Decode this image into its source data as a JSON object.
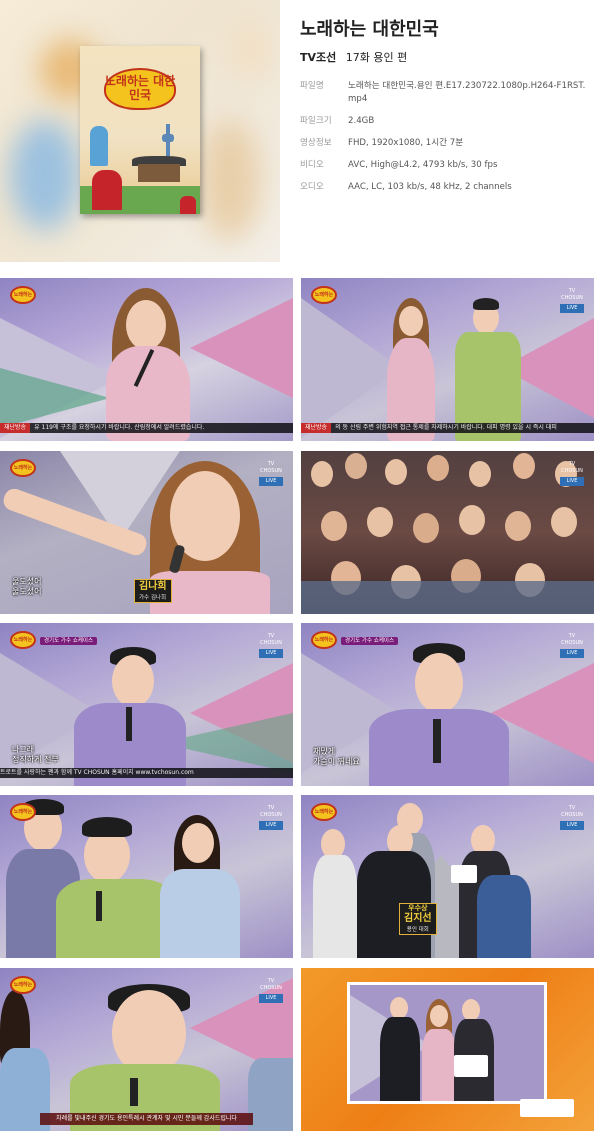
{
  "program": {
    "title": "노래하는 대한민국",
    "channel": "TV조선",
    "episode": "17화 용인 편",
    "poster_text": "노래하는 대한민국"
  },
  "meta": [
    {
      "key": "파일명",
      "value": "노래하는 대한민국.용인 편.E17.230722.1080p.H264-F1RST.mp4"
    },
    {
      "key": "파일크기",
      "value": "2.4GB"
    },
    {
      "key": "영상정보",
      "value": "FHD, 1920x1080, 1시간 7분"
    },
    {
      "key": "비디오",
      "value": "AVC, High@L4.2, 4793 kb/s, 30 fps"
    },
    {
      "key": "오디오",
      "value": "AAC, LC, 103 kb/s, 48 kHz, 2 channels"
    }
  ],
  "thumbs": {
    "t1": {
      "ticker_tag": "재난방송",
      "ticker": "유 119에 구조를 요청하시기 바랍니다. 산림청에서 알려드렸습니다."
    },
    "t2": {
      "ticker_tag": "재난방송",
      "ticker": "의 동 산림 주변 위험지역 접근 통제를 자제하시기 바랍니다. 대피 명령 있을 시 즉시 대피"
    },
    "t3": {
      "caption_line1": "울도셨어",
      "caption_line2": "울도셨어",
      "name": "김나희",
      "name_sub": "가수 김나희"
    },
    "t5": {
      "badge": "경기도 가수 쇼케이스",
      "caption_line1": "나그래",
      "caption_line2": "정직하게 전부",
      "ticker": "트로트를 사랑하는 팬과 함께 TV CHOSUN 홈페이지 www.tvchosun.com"
    },
    "t6": {
      "badge": "경기도 가수 쇼케이스",
      "caption_line1": "재밌게",
      "caption_line2": "가슴이 뛰네요"
    },
    "t8": {
      "award": "우수상",
      "name": "김지선",
      "name_sub": "용인 대회"
    },
    "t9": {
      "sub": "차례를 빛내주신 경기도 용인특례시 관계자 및 시민 분들께 감사드립니다"
    },
    "common": {
      "channel_logo": "TV CHOSUN",
      "live": "LIVE",
      "prog_logo": "노래하는"
    }
  },
  "colors": {
    "stage_purple": "#7b69b6",
    "stage_pink": "#d98ab6",
    "stage_gray": "#c9c8d2",
    "orange_frame": "#f08a1c"
  }
}
